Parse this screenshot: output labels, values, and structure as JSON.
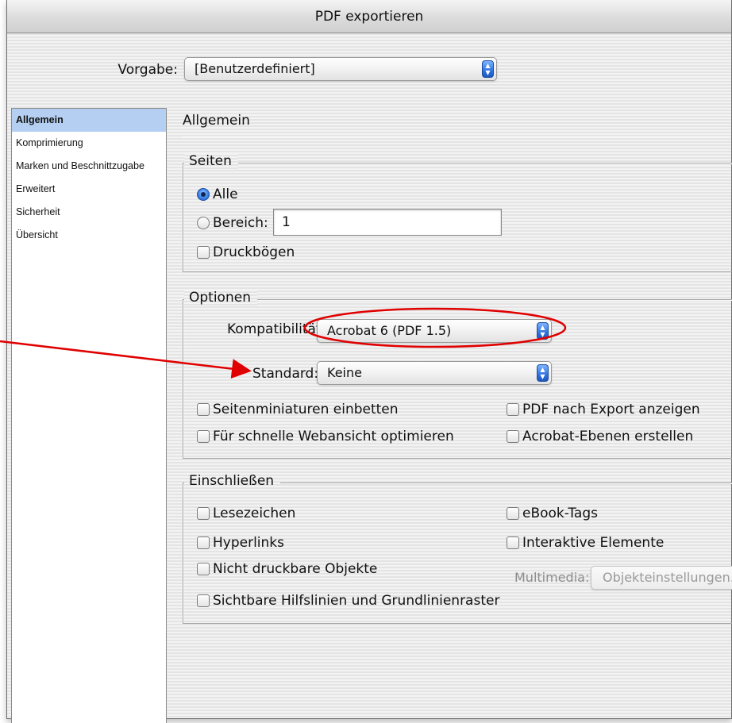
{
  "window": {
    "title": "PDF exportieren"
  },
  "preset": {
    "label": "Vorgabe:",
    "value": "[Benutzerdefiniert]"
  },
  "sidebar": {
    "items": [
      {
        "label": "Allgemein",
        "selected": true
      },
      {
        "label": "Komprimierung"
      },
      {
        "label": "Marken und Beschnittzugabe"
      },
      {
        "label": "Erweitert"
      },
      {
        "label": "Sicherheit"
      },
      {
        "label": "Übersicht"
      }
    ]
  },
  "main": {
    "title": "Allgemein",
    "pages": {
      "group_label": "Seiten",
      "all_label": "Alle",
      "range_label": "Bereich:",
      "range_value": "1",
      "spreads_label": "Druckbögen"
    },
    "options": {
      "group_label": "Optionen",
      "compat_label": "Kompatibilität:",
      "compat_value": "Acrobat 6 (PDF 1.5)",
      "standard_label": "Standard:",
      "standard_value": "Keine",
      "embed_thumbs": "Seitenminiaturen einbetten",
      "fast_web": "Für schnelle Webansicht optimieren",
      "view_after": "PDF nach Export anzeigen",
      "acrobat_layers": "Acrobat-Ebenen erstellen"
    },
    "include": {
      "group_label": "Einschließen",
      "bookmarks": "Lesezeichen",
      "hyperlinks": "Hyperlinks",
      "non_printing": "Nicht druckbare Objekte",
      "guides": "Sichtbare Hilfslinien und Grundlinienraster",
      "ebook_tags": "eBook-Tags",
      "interactive": "Interaktive Elemente",
      "multimedia_label": "Multimedia:",
      "multimedia_value": "Objekteinstellungen..."
    }
  },
  "colors": {
    "annotation_red": "#e00000",
    "selection_blue": "#b5cff2",
    "stepper_blue": "#2f74e0"
  }
}
